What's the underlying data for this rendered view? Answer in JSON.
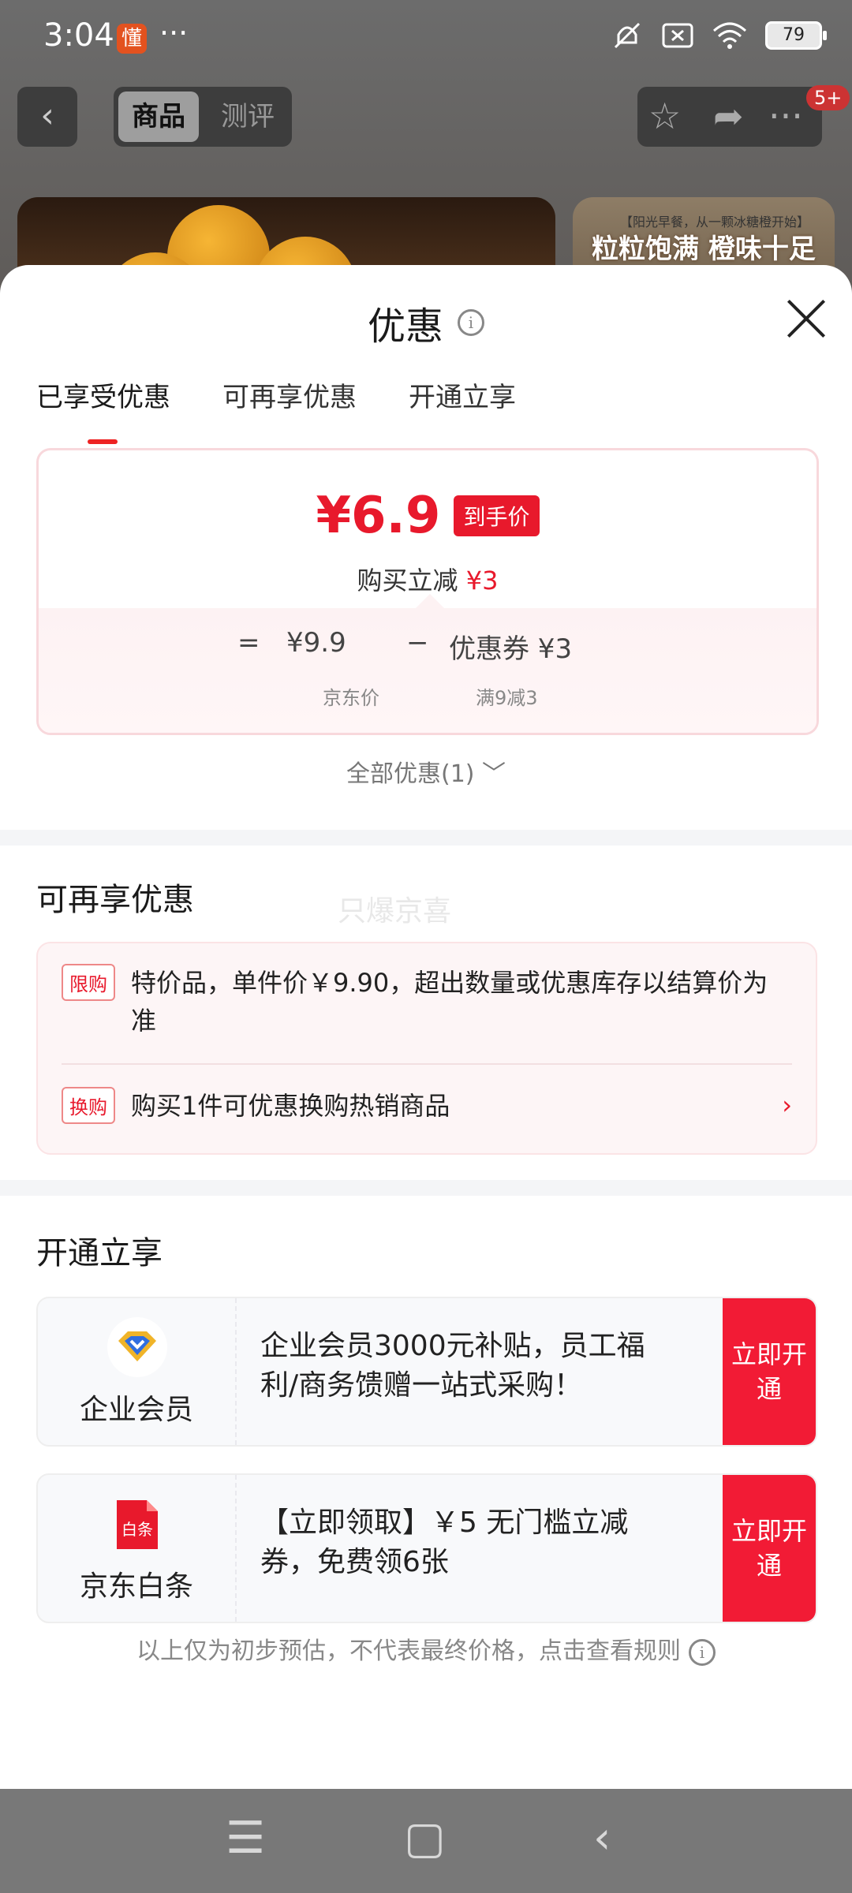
{
  "status_bar": {
    "time": "3:04",
    "app_badge": "懂",
    "more": "···",
    "battery": "79"
  },
  "nav": {
    "back_icon": "chevron-left-icon",
    "segments": [
      "商品",
      "测评"
    ],
    "badge": "5+"
  },
  "background_image": {
    "small_caption": "【阳光早餐，从一颗冰糖橙开始】",
    "caption": "粒粒饱满 橙味十足"
  },
  "sheet": {
    "title": "优惠",
    "tabs": [
      "已享受优惠",
      "可再享优惠",
      "开通立享"
    ],
    "price_card": {
      "final_price": "¥6.9",
      "final_tag": "到手价",
      "instant_off_label": "购买立减",
      "instant_off_value": "¥3",
      "equals": "=",
      "jd_price": "¥9.9",
      "minus": "−",
      "coupon": "优惠券 ¥3",
      "jd_price_label": "京东价",
      "coupon_rule": "满9减3"
    },
    "all_offers": "全部优惠(1) ﹀",
    "more_offers": {
      "title": "可再享优惠",
      "watermark": "只爆京喜",
      "items": [
        {
          "tag": "限购",
          "text": "特价品，单件价￥9.90，超出数量或优惠库存以结算价为准"
        },
        {
          "tag": "换购",
          "text": "购买1件可优惠换购热销商品",
          "arrow": "›"
        }
      ]
    },
    "open_now": {
      "title": "开通立享",
      "cards": [
        {
          "name": "企业会员",
          "desc": "企业会员3000元补贴，员工福利/商务馈赠一站式采购！",
          "button": "立即开通",
          "icon": "enterprise-member-icon"
        },
        {
          "name": "京东白条",
          "desc": "【立即领取】￥5 无门槛立减券，免费领6张",
          "button": "立即开通",
          "icon_text": "白条",
          "icon": "baitiao-icon"
        }
      ]
    },
    "disclaimer": "以上仅为初步预估，不代表最终价格，点击查看规则"
  },
  "colors": {
    "accent_red": "#e8192c",
    "button_red": "#f21b35"
  }
}
